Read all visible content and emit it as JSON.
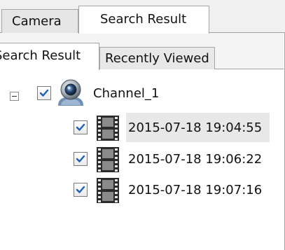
{
  "outer_tabs": {
    "camera": "Camera",
    "search_result": "Search Result"
  },
  "inner_tabs": {
    "search_result": "Search Result",
    "recently_viewed": "Recently Viewed"
  },
  "tree": {
    "channel": {
      "label": "Channel_1",
      "checked": true,
      "expanded": true,
      "icon": "webcam-icon"
    },
    "files": [
      {
        "label": "2015-07-18 19:04:55",
        "checked": true,
        "selected": true,
        "icon": "film-icon"
      },
      {
        "label": "2015-07-18 19:06:22",
        "checked": true,
        "selected": false,
        "icon": "film-icon"
      },
      {
        "label": "2015-07-18 19:07:16",
        "checked": true,
        "selected": false,
        "icon": "film-icon"
      }
    ]
  },
  "colors": {
    "check_blue": "#1f5fb5",
    "selection": "#e8e8e8",
    "tab_border": "#a6a6a6"
  }
}
